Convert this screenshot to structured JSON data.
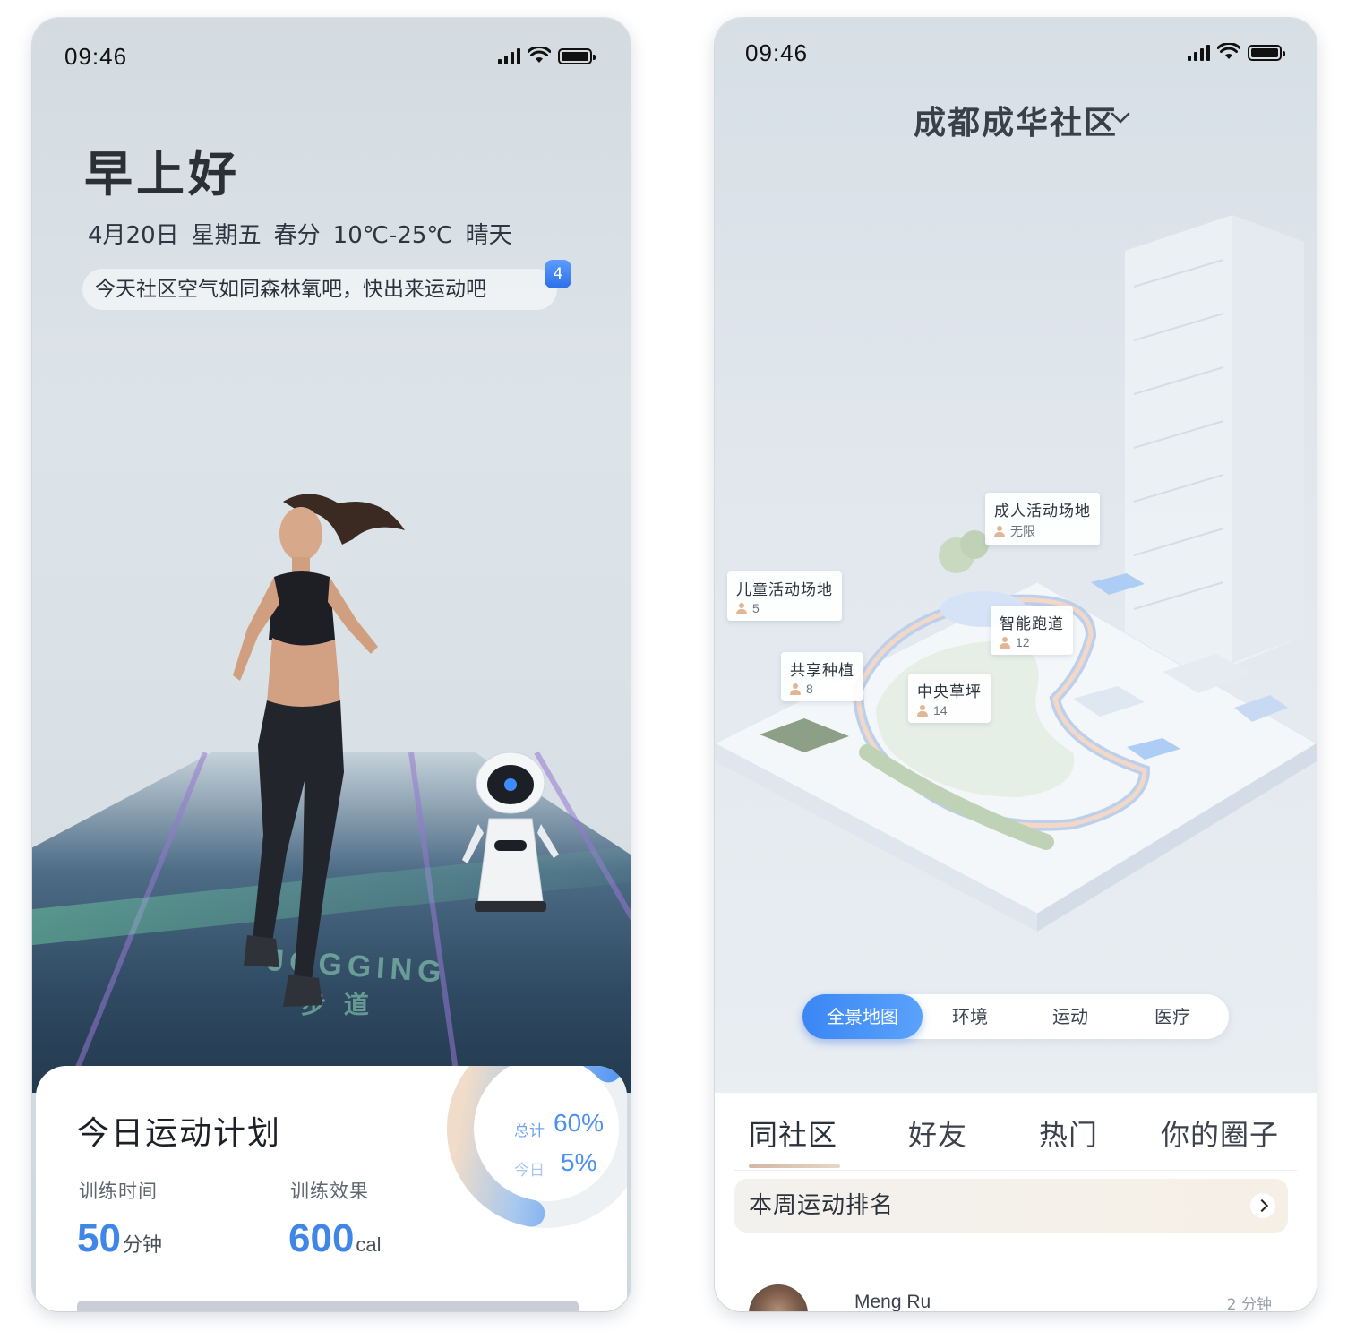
{
  "left_screen": {
    "status": {
      "time": "09:46"
    },
    "greeting": "早上好",
    "date_parts": [
      "4月20日",
      "星期五",
      "春分",
      "10℃-25℃",
      "晴天"
    ],
    "message": "今天社区空气如同森林氧吧，快出来运动吧",
    "message_badge": "4",
    "track_texts": [
      "JOGGING",
      "步 道"
    ],
    "plan": {
      "title": "今日运动计划",
      "training_time_label": "训练时间",
      "training_time_value": "50",
      "training_time_unit": "分钟",
      "training_effect_label": "训练效果",
      "training_effect_value": "600",
      "training_effect_unit": "cal",
      "total_label": "总计",
      "total_value": "60%",
      "today_label": "今日",
      "today_value": "5%"
    }
  },
  "right_screen": {
    "status": {
      "time": "09:46"
    },
    "community_name": "成都成华社区",
    "locations": [
      {
        "name": "成人活动场地",
        "count": "无限"
      },
      {
        "name": "儿童活动场地",
        "count": "5"
      },
      {
        "name": "智能跑道",
        "count": "12"
      },
      {
        "name": "共享种植",
        "count": "8"
      },
      {
        "name": "中央草坪",
        "count": "14"
      }
    ],
    "segments": [
      "全景地图",
      "环境",
      "运动",
      "医疗"
    ],
    "active_segment": "全景地图",
    "social_tabs": [
      "同社区",
      "好友",
      "热门",
      "你的圈子"
    ],
    "active_social_tab": "同社区",
    "ranking_label": "本周运动排名",
    "feed": [
      {
        "name": "Meng Ru",
        "time": "2 分钟"
      }
    ]
  },
  "colors": {
    "accent_blue": "#3f86e6",
    "segment_active": "#3b86f4",
    "badge_blue": "#2f6fe8",
    "underline_tan": "#d2b7a3"
  },
  "progress": {
    "total_fraction": 0.6,
    "today_fraction": 0.05
  }
}
